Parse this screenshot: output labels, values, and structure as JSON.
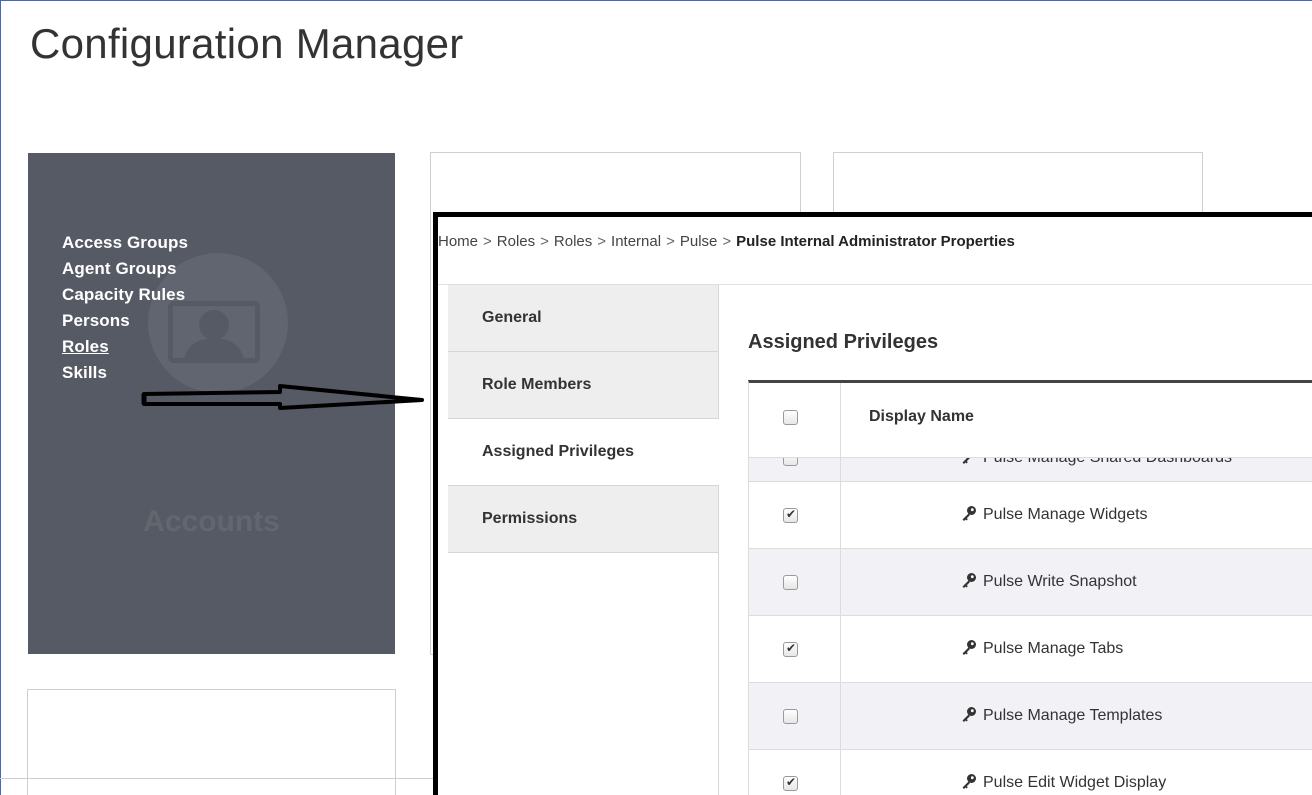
{
  "page": {
    "title": "Configuration Manager"
  },
  "accounts": {
    "label": "Accounts",
    "links": [
      "Access Groups",
      "Agent Groups",
      "Capacity Rules",
      "Persons",
      "Roles",
      "Skills"
    ]
  },
  "panel": {
    "breadcrumb": [
      "Home",
      "Roles",
      "Roles",
      "Internal",
      "Pulse"
    ],
    "breadcrumb_separator": ">",
    "breadcrumb_current": "Pulse Internal Administrator Properties",
    "tabs": [
      {
        "label": "General",
        "active": false
      },
      {
        "label": "Role Members",
        "active": false
      },
      {
        "label": "Assigned Privileges",
        "active": true
      },
      {
        "label": "Permissions",
        "active": false
      }
    ],
    "section_title": "Assigned Privileges",
    "table": {
      "header_name": "Display Name",
      "rows": [
        {
          "name": "Pulse Manage Shared Dashboards",
          "checked": false,
          "partial": true
        },
        {
          "name": "Pulse Manage Widgets",
          "checked": true
        },
        {
          "name": "Pulse Write Snapshot",
          "checked": false
        },
        {
          "name": "Pulse Manage Tabs",
          "checked": true
        },
        {
          "name": "Pulse Manage Templates",
          "checked": false
        },
        {
          "name": "Pulse Edit Widget Display",
          "checked": true
        }
      ]
    }
  }
}
